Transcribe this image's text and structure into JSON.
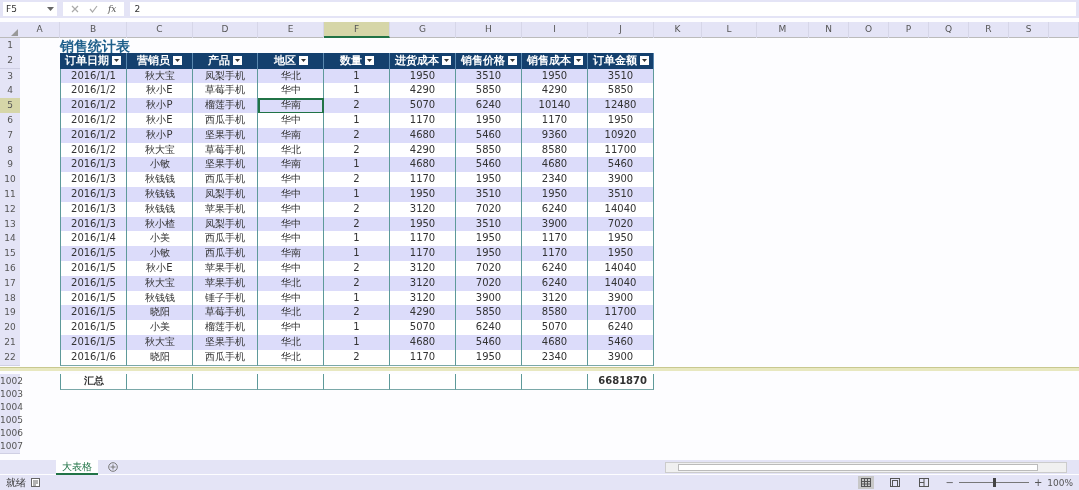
{
  "name_box": "F5",
  "formula_bar": {
    "function_label": "fx",
    "value": "2"
  },
  "columns": [
    {
      "label": "A",
      "selected": false
    },
    {
      "label": "B",
      "selected": false
    },
    {
      "label": "C",
      "selected": false
    },
    {
      "label": "D",
      "selected": false
    },
    {
      "label": "E",
      "selected": false
    },
    {
      "label": "F",
      "selected": true
    },
    {
      "label": "G",
      "selected": false
    },
    {
      "label": "H",
      "selected": false
    },
    {
      "label": "I",
      "selected": false
    },
    {
      "label": "J",
      "selected": false
    },
    {
      "label": "K",
      "selected": false
    },
    {
      "label": "L",
      "selected": false
    },
    {
      "label": "M",
      "selected": false
    },
    {
      "label": "N",
      "selected": false
    },
    {
      "label": "O",
      "selected": false
    },
    {
      "label": "P",
      "selected": false
    },
    {
      "label": "Q",
      "selected": false
    },
    {
      "label": "R",
      "selected": false
    },
    {
      "label": "S",
      "selected": false
    }
  ],
  "rows": [
    {
      "number": "1",
      "selected": false,
      "kind": "title",
      "title": "销售统计表"
    },
    {
      "number": "2",
      "selected": false,
      "kind": "header",
      "cells": [
        "订单日期",
        "营销员",
        "产品",
        "地区",
        "数量",
        "进货成本",
        "销售价格",
        "销售成本",
        "订单金额"
      ]
    },
    {
      "number": "3",
      "selected": false,
      "kind": "record",
      "cells": [
        "2016/1/1",
        "秋大宝",
        "凤梨手机",
        "华北",
        "1",
        "1950",
        "3510",
        "1950",
        "3510"
      ]
    },
    {
      "number": "4",
      "selected": false,
      "kind": "record",
      "cells": [
        "2016/1/2",
        "秋小E",
        "草莓手机",
        "华中",
        "1",
        "4290",
        "5850",
        "4290",
        "5850"
      ]
    },
    {
      "number": "5",
      "selected": true,
      "kind": "record",
      "cells": [
        "2016/1/2",
        "秋小P",
        "榴莲手机",
        "华南",
        "2",
        "5070",
        "6240",
        "10140",
        "12480"
      ]
    },
    {
      "number": "6",
      "selected": false,
      "kind": "record",
      "cells": [
        "2016/1/2",
        "秋小E",
        "西瓜手机",
        "华中",
        "1",
        "1170",
        "1950",
        "1170",
        "1950"
      ]
    },
    {
      "number": "7",
      "selected": false,
      "kind": "record",
      "cells": [
        "2016/1/2",
        "秋小P",
        "坚果手机",
        "华南",
        "2",
        "4680",
        "5460",
        "9360",
        "10920"
      ]
    },
    {
      "number": "8",
      "selected": false,
      "kind": "record",
      "cells": [
        "2016/1/2",
        "秋大宝",
        "草莓手机",
        "华北",
        "2",
        "4290",
        "5850",
        "8580",
        "11700"
      ]
    },
    {
      "number": "9",
      "selected": false,
      "kind": "record",
      "cells": [
        "2016/1/3",
        "小敏",
        "坚果手机",
        "华南",
        "1",
        "4680",
        "5460",
        "4680",
        "5460"
      ]
    },
    {
      "number": "10",
      "selected": false,
      "kind": "record",
      "cells": [
        "2016/1/3",
        "秋钱钱",
        "西瓜手机",
        "华中",
        "2",
        "1170",
        "1950",
        "2340",
        "3900"
      ]
    },
    {
      "number": "11",
      "selected": false,
      "kind": "record",
      "cells": [
        "2016/1/3",
        "秋钱钱",
        "凤梨手机",
        "华中",
        "1",
        "1950",
        "3510",
        "1950",
        "3510"
      ]
    },
    {
      "number": "12",
      "selected": false,
      "kind": "record",
      "cells": [
        "2016/1/3",
        "秋钱钱",
        "苹果手机",
        "华中",
        "2",
        "3120",
        "7020",
        "6240",
        "14040"
      ]
    },
    {
      "number": "13",
      "selected": false,
      "kind": "record",
      "cells": [
        "2016/1/3",
        "秋小楂",
        "凤梨手机",
        "华中",
        "2",
        "1950",
        "3510",
        "3900",
        "7020"
      ]
    },
    {
      "number": "14",
      "selected": false,
      "kind": "record",
      "cells": [
        "2016/1/4",
        "小美",
        "西瓜手机",
        "华中",
        "1",
        "1170",
        "1950",
        "1170",
        "1950"
      ]
    },
    {
      "number": "15",
      "selected": false,
      "kind": "record",
      "cells": [
        "2016/1/5",
        "小敏",
        "西瓜手机",
        "华南",
        "1",
        "1170",
        "1950",
        "1170",
        "1950"
      ]
    },
    {
      "number": "16",
      "selected": false,
      "kind": "record",
      "cells": [
        "2016/1/5",
        "秋小E",
        "苹果手机",
        "华中",
        "2",
        "3120",
        "7020",
        "6240",
        "14040"
      ]
    },
    {
      "number": "17",
      "selected": false,
      "kind": "record",
      "cells": [
        "2016/1/5",
        "秋大宝",
        "苹果手机",
        "华北",
        "2",
        "3120",
        "7020",
        "6240",
        "14040"
      ]
    },
    {
      "number": "18",
      "selected": false,
      "kind": "record",
      "cells": [
        "2016/1/5",
        "秋钱钱",
        "锤子手机",
        "华中",
        "1",
        "3120",
        "3900",
        "3120",
        "3900"
      ]
    },
    {
      "number": "19",
      "selected": false,
      "kind": "record",
      "cells": [
        "2016/1/5",
        "晓阳",
        "草莓手机",
        "华北",
        "2",
        "4290",
        "5850",
        "8580",
        "11700"
      ]
    },
    {
      "number": "20",
      "selected": false,
      "kind": "record",
      "cells": [
        "2016/1/5",
        "小美",
        "榴莲手机",
        "华中",
        "1",
        "5070",
        "6240",
        "5070",
        "6240"
      ]
    },
    {
      "number": "21",
      "selected": false,
      "kind": "record",
      "cells": [
        "2016/1/5",
        "秋大宝",
        "坚果手机",
        "华北",
        "1",
        "4680",
        "5460",
        "4680",
        "5460"
      ]
    },
    {
      "number": "22",
      "selected": false,
      "kind": "record",
      "cells": [
        "2016/1/6",
        "晓阳",
        "西瓜手机",
        "华北",
        "2",
        "1170",
        "1950",
        "2340",
        "3900"
      ]
    },
    {
      "number": "1002",
      "selected": false,
      "kind": "total",
      "label": "汇总",
      "amount": "6681870"
    },
    {
      "number": "1003",
      "selected": false,
      "kind": "empty"
    },
    {
      "number": "1004",
      "selected": false,
      "kind": "empty"
    },
    {
      "number": "1005",
      "selected": false,
      "kind": "empty"
    },
    {
      "number": "1006",
      "selected": false,
      "kind": "empty"
    },
    {
      "number": "1007",
      "selected": false,
      "kind": "empty"
    }
  ],
  "sheet_tabs": [
    {
      "label": "大表格",
      "selected": true
    }
  ],
  "status": "就绪",
  "views": [
    {
      "kind": "normal",
      "selected": true
    },
    {
      "kind": "page_layout",
      "selected": false
    },
    {
      "kind": "page_break",
      "selected": false
    }
  ],
  "zoom": {
    "minus": "−",
    "plus": "+",
    "level": 0.5,
    "reading": "100%"
  }
}
